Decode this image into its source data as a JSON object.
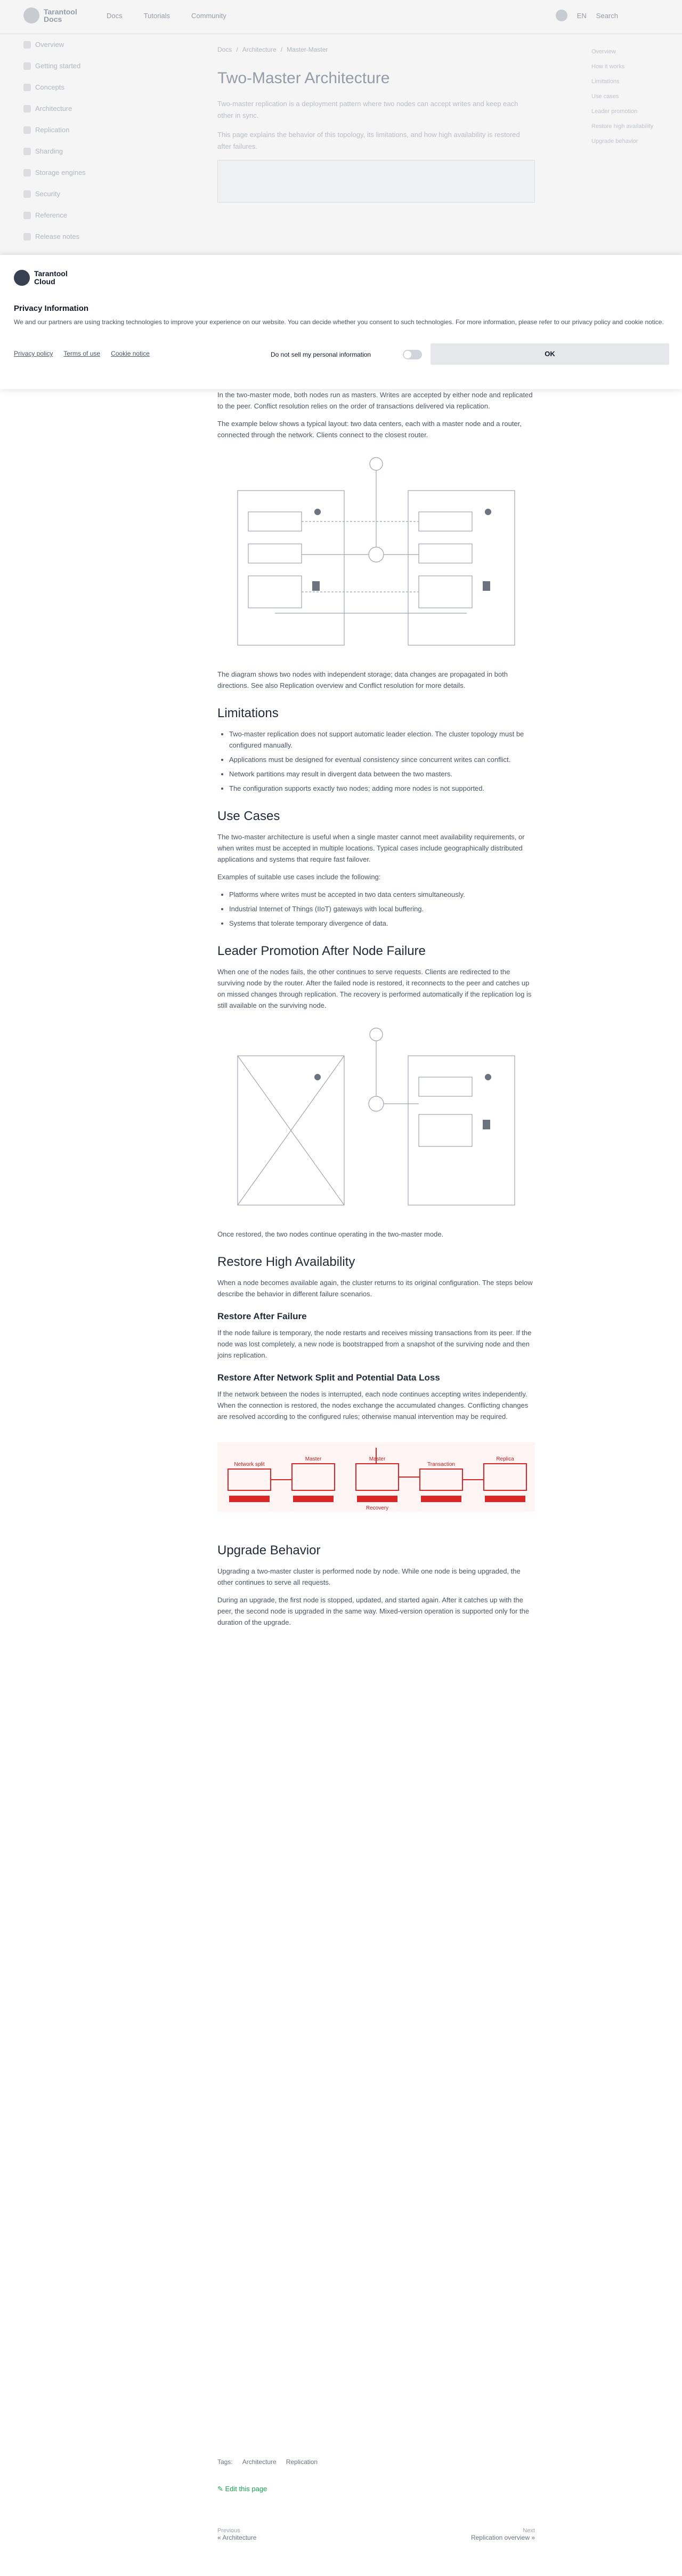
{
  "header": {
    "logo_line1": "Tarantool",
    "logo_line2": "Docs",
    "nav": [
      "Docs",
      "Tutorials",
      "Community"
    ],
    "lang": "EN",
    "search": "Search"
  },
  "sidebar": {
    "items": [
      "Overview",
      "Getting started",
      "Concepts",
      "Architecture",
      "Replication",
      "Sharding",
      "Storage engines",
      "Security",
      "Reference",
      "Release notes"
    ]
  },
  "toc": {
    "items": [
      "Overview",
      "How it works",
      "Limitations",
      "Use cases",
      "Leader promotion",
      "Restore high availability",
      "Upgrade behavior"
    ]
  },
  "page": {
    "breadcrumb": [
      "Docs",
      "Architecture",
      "Master-Master"
    ],
    "title": "Two-Master Architecture",
    "intro1": "Two-master replication is a deployment pattern where two nodes can accept writes and keep each other in sync.",
    "intro2": "This page explains the behavior of this topology, its limitations, and how high availability is restored after failures."
  },
  "consent": {
    "logo_line1": "Tarantool",
    "logo_line2": "Cloud",
    "title": "Privacy Information",
    "text": "We and our partners are using tracking technologies to improve your experience on our website. You can decide whether you consent to such technologies. For more information, please refer to our privacy policy and cookie notice.",
    "links": [
      "Privacy policy",
      "Terms of use",
      "Cookie notice"
    ],
    "dns_label": "Do not sell my personal information",
    "ok": "OK"
  },
  "content": {
    "p1": "In the two-master mode, both nodes run as masters. Writes are accepted by either node and replicated to the peer. Conflict resolution relies on the order of transactions delivered via replication.",
    "p2": "The example below shows a typical layout: two data centers, each with a master node and a router, connected through the network. Clients connect to the closest router.",
    "p3": "The diagram shows two nodes with independent storage; data changes are propagated in both directions. See also Replication overview and Conflict resolution for more details.",
    "h_limit": "Limitations",
    "limits": [
      "Two-master replication does not support automatic leader election. The cluster topology must be configured manually.",
      "Applications must be designed for eventual consistency since concurrent writes can conflict.",
      "Network partitions may result in divergent data between the two masters.",
      "The configuration supports exactly two nodes; adding more nodes is not supported."
    ],
    "h_use": "Use Cases",
    "p_use": "The two-master architecture is useful when a single master cannot meet availability requirements, or when writes must be accepted in multiple locations. Typical cases include geographically distributed applications and systems that require fast failover.",
    "p_use2": "Examples of suitable use cases include the following:",
    "uses": [
      "Platforms where writes must be accepted in two data centers simultaneously.",
      "Industrial Internet of Things (IIoT) gateways with local buffering.",
      "Systems that tolerate temporary divergence of data."
    ],
    "h_leader": "Leader Promotion After Node Failure",
    "p_leader": "When one of the nodes fails, the other continues to serve requests. Clients are redirected to the surviving node by the router. After the failed node is restored, it reconnects to the peer and catches up on missed changes through replication. The recovery is performed automatically if the replication log is still available on the surviving node.",
    "p_leader2": "Once restored, the two nodes continue operating in the two-master mode.",
    "h_restore": "Restore High Availability",
    "p_restore": "When a node becomes available again, the cluster returns to its original configuration. The steps below describe the behavior in different failure scenarios.",
    "h_restore1": "Restore After Failure",
    "p_restore1": "If the node failure is temporary, the node restarts and receives missing transactions from its peer. If the node was lost completely, a new node is bootstrapped from a snapshot of the surviving node and then joins replication.",
    "h_restore2": "Restore After Network Split and Potential Data Loss",
    "p_restore2": "If the network between the nodes is interrupted, each node continues accepting writes independently. When the connection is restored, the nodes exchange the accumulated changes. Conflicting changes are resolved according to the configured rules; otherwise manual intervention may be required.",
    "banner_labels": [
      "Network split",
      "Master",
      "Master",
      "Transaction",
      "Replica",
      "Recovery"
    ],
    "h_upgrade": "Upgrade Behavior",
    "p_upgrade": "Upgrading a two-master cluster is performed node by node. While one node is being upgraded, the other continues to serve all requests.",
    "p_upgrade2": "During an upgrade, the first node is stopped, updated, and started again. After it catches up with the peer, the second node is upgraded in the same way. Mixed-version operation is supported only for the duration of the upgrade."
  },
  "footer": {
    "tags_label": "Tags:",
    "tags": [
      "Architecture",
      "Replication"
    ],
    "edit": "Edit this page",
    "prev_label": "Previous",
    "prev_title": "« Architecture",
    "next_label": "Next",
    "next_title": "Replication overview »"
  }
}
